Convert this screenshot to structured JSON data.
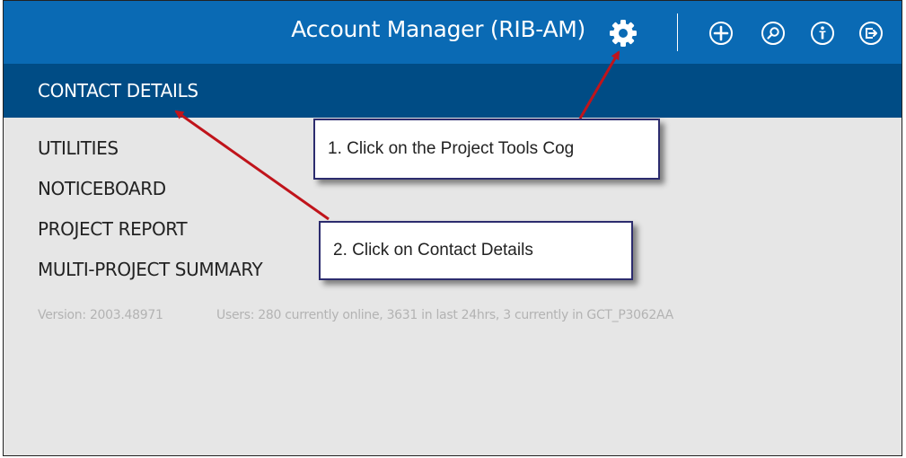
{
  "header": {
    "title": "Account Manager (RIB-AM)",
    "icons": [
      "gear-icon",
      "add-icon",
      "search-icon",
      "info-icon",
      "exit-icon"
    ],
    "bar_color": "#0a6ab4"
  },
  "nav": {
    "active_label": "CONTACT DETAILS",
    "bar_color": "#004c85"
  },
  "menu": {
    "items": [
      {
        "label": "UTILITIES"
      },
      {
        "label": "NOTICEBOARD"
      },
      {
        "label": "PROJECT REPORT"
      },
      {
        "label": "MULTI-PROJECT SUMMARY"
      }
    ]
  },
  "status": {
    "version": "Version: 2003.48971",
    "users": "Users: 280 currently online, 3631 in last 24hrs, 3 currently in GCT_P3062AA"
  },
  "callouts": {
    "step1": "1. Click on the Project Tools Cog",
    "step2": "2. Click on Contact Details"
  },
  "colors": {
    "arrow": "#c0141b",
    "callout_border": "#2c2c6e",
    "background": "#e6e6e6"
  }
}
